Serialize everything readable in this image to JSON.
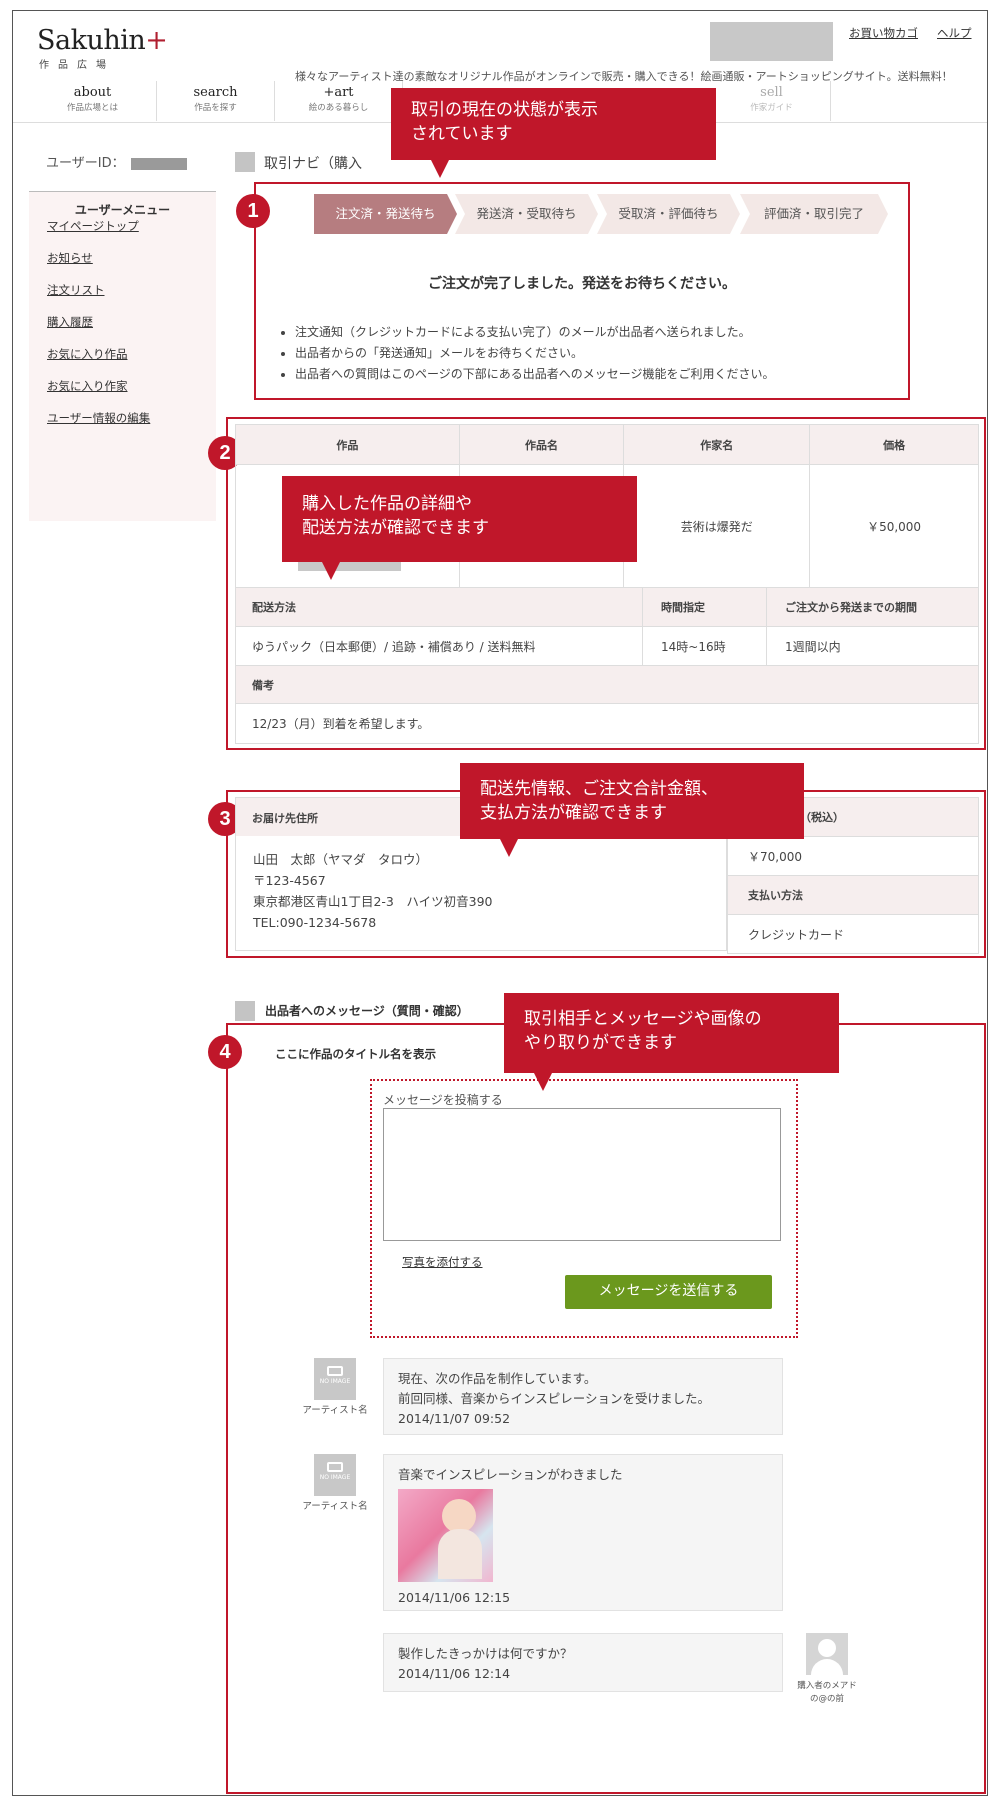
{
  "logo": {
    "main": "Sakuhin",
    "plus": "+",
    "sub": "作品広場"
  },
  "header": {
    "cart_link": "お買い物カゴ",
    "help_link": "ヘルプ",
    "tagline": "様々なアーティスト達の素敵なオリジナル作品がオンラインで販売・購入できる！絵画通販・アートショッピングサイト。送料無料！"
  },
  "nav": [
    {
      "title": "about",
      "sub": "作品広場とは"
    },
    {
      "title": "search",
      "sub": "作品を探す"
    },
    {
      "title": "+art",
      "sub": "絵のある暮らし"
    },
    {
      "title": "sell",
      "sub": "作家ガイド"
    }
  ],
  "sidebar": {
    "user_id_label": "ユーザーID：",
    "menu_title": "ユーザーメニュー",
    "items": [
      "マイページトップ",
      "お知らせ",
      "注文リスト",
      "購入履歴",
      "お気に入り作品",
      "お気に入り作家",
      "ユーザー情報の編集"
    ]
  },
  "page_title": "取引ナビ（購入",
  "callouts": [
    "取引の現在の状態が表示\nされています",
    "購入した作品の詳細や\n配送方法が確認できます",
    "配送先情報、ご注文合計金額、\n支払方法が確認できます",
    "取引相手とメッセージや画像の\nやり取りができます"
  ],
  "numbers": [
    "1",
    "2",
    "3",
    "4"
  ],
  "steps": [
    "注文済・発送待ち",
    "発送済・受取待ち",
    "受取済・評価待ち",
    "評価済・取引完了"
  ],
  "status": {
    "heading": "ご注文が完了しました。発送をお待ちください。",
    "bullets": [
      "注文通知（クレジットカードによる支払い完了）のメールが出品者へ送られました。",
      "出品者からの「発送通知」メールをお待ちください。",
      "出品者への質問はこのページの下部にある出品者へのメッセージ機能をご利用ください。"
    ]
  },
  "order": {
    "headers": [
      "作品",
      "作品名",
      "作家名",
      "価格"
    ],
    "artist": "芸術は爆発だ",
    "price": "￥50,000",
    "ship_headers": [
      "配送方法",
      "時間指定",
      "ご注文から発送までの期間"
    ],
    "ship_method": "ゆうパック（日本郵便）/ 追跡・補償あり / 送料無料",
    "ship_time": "14時~16時",
    "ship_period": "1週間以内",
    "note_header": "備考",
    "note": "12/23（月）到着を希望します。"
  },
  "address": {
    "header": "お届け先住所",
    "name": "山田　太郎（ヤマダ　タロウ）",
    "zip": "〒123-4567",
    "addr": "東京都港区青山1丁目2-3　ハイツ初音390",
    "tel": "TEL:090-1234-5678",
    "total_header_suffix": "（税込）",
    "total": "￥70,000",
    "pay_header": "支払い方法",
    "pay": "クレジットカード"
  },
  "messages": {
    "section_title": "出品者へのメッセージ（質問・確認）",
    "work_title": "ここに作品のタイトル名を表示",
    "post_label": "メッセージを投稿する",
    "attach_link": "写真を添付する",
    "send_button": "メッセージを送信する",
    "noimage": "NO IMAGE",
    "thread": [
      {
        "author": "アーティスト名",
        "lines": [
          "現在、次の作品を制作しています。",
          "前回同様、音楽からインスピレーションを受けました。"
        ],
        "time": "2014/11/07 09:52"
      },
      {
        "author": "アーティスト名",
        "lines": [
          "音楽でインスピレーションがわきました"
        ],
        "time": "2014/11/06 12:15"
      },
      {
        "author": "購入者のメアドの@の前",
        "lines": [
          "製作したきっかけは何ですか？"
        ],
        "time": "2014/11/06 12:14"
      }
    ]
  },
  "colors": {
    "accent_red": "#c0172a",
    "step_active": "#b67d80",
    "send_green": "#6b981d"
  }
}
